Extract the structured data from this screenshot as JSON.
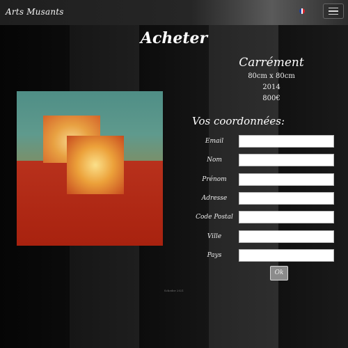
{
  "navbar": {
    "brand": "Arts Musants",
    "language_flag_icon": "french-flag-icon",
    "menu_icon": "hamburger-menu-icon"
  },
  "page": {
    "title": "Acheter"
  },
  "artwork": {
    "title": "Carrément",
    "dimensions": "80cm x 80cm",
    "year": "2014",
    "price": "800€"
  },
  "form": {
    "title": "Vos coordonnées:",
    "fields": [
      {
        "label": "Email",
        "value": "",
        "placeholder": ""
      },
      {
        "label": "Nom",
        "value": "",
        "placeholder": ""
      },
      {
        "label": "Prénom",
        "value": "",
        "placeholder": ""
      },
      {
        "label": "Adresse",
        "value": "",
        "placeholder": ""
      },
      {
        "label": "Code Postal",
        "value": "",
        "placeholder": ""
      },
      {
        "label": "Ville",
        "value": "",
        "placeholder": ""
      },
      {
        "label": "Pays",
        "value": "",
        "placeholder": ""
      }
    ],
    "submit_label": "Ok"
  },
  "footer": {
    "note": "Scheder 2021"
  },
  "colors": {
    "flag_blue": "#1f3f9a",
    "flag_white": "#ffffff",
    "flag_red": "#d8262d"
  }
}
